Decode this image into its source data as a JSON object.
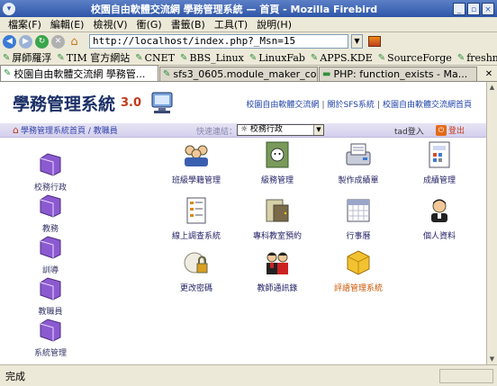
{
  "window": {
    "title": "校園自由軟體交流網 學務管理系統 — 首頁 - Mozilla Firebird",
    "menu_glyph": "▾",
    "controls": [
      "_",
      "▫",
      "×"
    ]
  },
  "menubar": [
    "檔案(F)",
    "編輯(E)",
    "檢視(V)",
    "衝(G)",
    "書籤(B)",
    "工具(T)",
    "說明(H)"
  ],
  "navigation": {
    "back_icon": "arrow-left-icon",
    "url": "http://localhost/index.php?_Msn=15"
  },
  "bookmarks": [
    "屏師羅浮",
    "TIM 官方網站",
    "CNET",
    "BBS_Linux",
    "LinuxFab",
    "APPS.KDE",
    "SourceForge",
    "freshmeat"
  ],
  "tabs": [
    {
      "label": "校園自由軟體交流網 學務管...",
      "active": true
    },
    {
      "label": "sfs3_0605.module_maker_co...",
      "active": false
    },
    {
      "label": "PHP: function_exists - Ma...",
      "active": false
    }
  ],
  "page": {
    "title": "學務管理系統",
    "version": "3.0",
    "top_links": [
      "校園自由軟體交流網",
      "關於SFS系統",
      "校園自由軟體交流網首頁"
    ],
    "breadcrumb": "學務管理系統首頁 / 教職員",
    "quick_label": "快速連結：",
    "quick_select": "☼ 校務行政",
    "user": "tad登入",
    "logout": "登出"
  },
  "sidebar": [
    "校務行政",
    "教務",
    "訓導",
    "教職員",
    "系統管理"
  ],
  "apps": [
    {
      "label": "班級學籍管理",
      "icon": "students-icon",
      "hot": false
    },
    {
      "label": "級務管理",
      "icon": "class-affairs-icon",
      "hot": false
    },
    {
      "label": "製作成績單",
      "icon": "report-card-icon",
      "hot": false
    },
    {
      "label": "成績管理",
      "icon": "grades-icon",
      "hot": false
    },
    {
      "label": "線上調查系統",
      "icon": "survey-icon",
      "hot": false
    },
    {
      "label": "專科教室預約",
      "icon": "classroom-booking-icon",
      "hot": false
    },
    {
      "label": "行事曆",
      "icon": "calendar-icon",
      "hot": false
    },
    {
      "label": "個人資料",
      "icon": "profile-icon",
      "hot": false
    },
    {
      "label": "更改密碼",
      "icon": "password-icon",
      "hot": false
    },
    {
      "label": "教師通訊錄",
      "icon": "teachers-directory-icon",
      "hot": false
    },
    {
      "label": "評語管理系統",
      "icon": "comments-icon",
      "hot": true
    }
  ],
  "status": "完成",
  "colors": {
    "title_blue": "#1a2f66",
    "accent_red": "#c23a1a",
    "link_blue": "#2244aa"
  }
}
